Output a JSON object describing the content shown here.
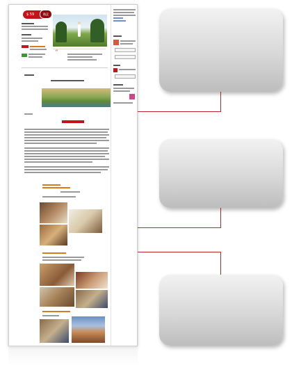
{
  "thumbnail": {
    "price_label": "$ 59",
    "buy_label": "购买",
    "quote_mark": "“"
  },
  "callouts": [
    {
      "label": ""
    },
    {
      "label": ""
    },
    {
      "label": ""
    }
  ],
  "colors": {
    "accent": "#c4141b",
    "connector": "#c0242a",
    "box": "#d0d0d0"
  }
}
